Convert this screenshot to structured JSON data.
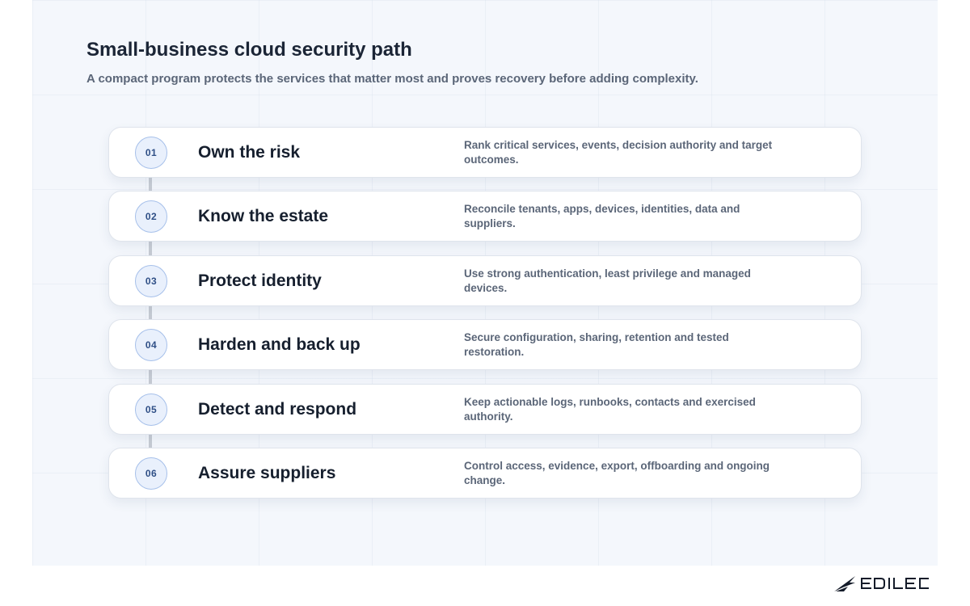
{
  "header": {
    "title": "Small-business cloud security path",
    "subtitle": "A compact program protects the services that matter most and proves recovery before adding complexity."
  },
  "steps": [
    {
      "number": "01",
      "title": "Own the risk",
      "description": "Rank critical services, events, decision authority and target outcomes."
    },
    {
      "number": "02",
      "title": "Know the estate",
      "description": "Reconcile tenants, apps, devices, identities, data and suppliers."
    },
    {
      "number": "03",
      "title": "Protect identity",
      "description": "Use strong authentication, least privilege and managed devices."
    },
    {
      "number": "04",
      "title": "Harden and back up",
      "description": "Secure configuration, sharing, retention and tested restoration."
    },
    {
      "number": "05",
      "title": "Detect and respond",
      "description": "Keep actionable logs, runbooks, contacts and exercised authority."
    },
    {
      "number": "06",
      "title": "Assure suppliers",
      "description": "Control access, evidence, export, offboarding and ongoing change."
    }
  ],
  "brand": {
    "logo_text": "EDILEC",
    "logo_icon": "edilec-wing-icon",
    "color": "#141b29"
  },
  "colors": {
    "accent": "#2f4f86",
    "badge_fill": "#e9f0fc",
    "badge_border": "#a6c0ea",
    "connector": "#c7ccd4"
  }
}
